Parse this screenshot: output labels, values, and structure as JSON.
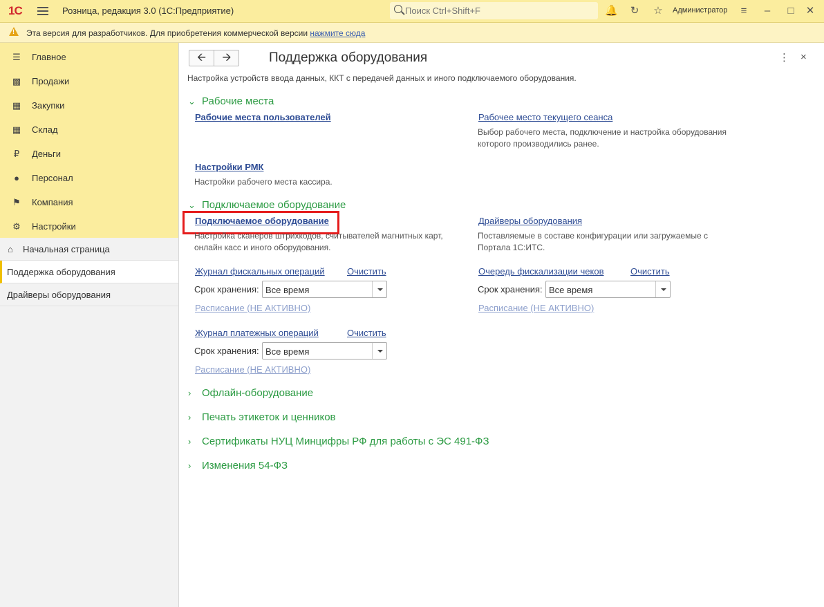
{
  "topbar": {
    "logo": "1С",
    "app_title": "Розница, редакция 3.0  (1С:Предприятие)",
    "search_placeholder": "Поиск Ctrl+Shift+F",
    "user": "Администратор",
    "icons": [
      "bell-icon",
      "history-icon",
      "star-icon",
      "settings-icon",
      "minimize-icon",
      "maximize-icon",
      "close-icon"
    ]
  },
  "warning": {
    "text": "Эта версия для разработчиков. Для приобретения коммерческой версии ",
    "link": "нажмите сюда"
  },
  "sections": [
    {
      "label": "Главное",
      "icon": "menu-icon"
    },
    {
      "label": "Продажи",
      "icon": "basket-icon"
    },
    {
      "label": "Закупки",
      "icon": "cart-icon"
    },
    {
      "label": "Склад",
      "icon": "warehouse-icon"
    },
    {
      "label": "Деньги",
      "icon": "ruble-icon"
    },
    {
      "label": "Персонал",
      "icon": "people-icon"
    },
    {
      "label": "Компания",
      "icon": "flag-icon"
    },
    {
      "label": "Настройки",
      "icon": "gear-icon"
    }
  ],
  "open_windows": [
    {
      "label": "Начальная страница"
    },
    {
      "label": "Поддержка оборудования"
    },
    {
      "label": "Драйверы оборудования"
    }
  ],
  "main": {
    "title": "Поддержка оборудования",
    "description": "Настройка устройств ввода данных, ККТ с передачей данных и иного подключаемого оборудования.",
    "groups": {
      "workplaces": {
        "title": "Рабочие места",
        "users_link": "Рабочие места пользователей",
        "current_link": "Рабочее место текущего сеанса",
        "current_note": "Выбор рабочего места, подключение и настройка оборудования которого производились ранее.",
        "rmk_link": "Настройки РМК",
        "rmk_note": "Настройки рабочего места кассира."
      },
      "equipment": {
        "title": "Подключаемое оборудование",
        "equipment_link": "Подключаемое оборудование",
        "equipment_note": "Настройка сканеров штрихкодов, считывателей магнитных карт, онлайн касс и иного оборудования.",
        "drivers_link": "Драйверы оборудования",
        "drivers_note": "Поставляемые в составе конфигурации или загружаемые с Портала 1С:ИТС.",
        "fiscal_log_link": "Журнал фискальных операций",
        "clear": "Очистить",
        "storage_label": "Срок хранения:",
        "storage_value": "Все время",
        "schedule": "Расписание (НЕ АКТИВНО)",
        "queue_link": "Очередь фискализации чеков",
        "payment_log_link": "Журнал платежных операций"
      }
    },
    "collapsed_groups": [
      "Офлайн-оборудование",
      "Печать этикеток и ценников",
      "Сертификаты НУЦ Минцифры РФ для работы с ЭС 491-ФЗ",
      "Изменения 54-ФЗ"
    ]
  },
  "colors": {
    "topbar": "#fbed9e",
    "group_title": "#2c9b43",
    "link": "#2f4d95",
    "highlight": "#e51c1c"
  }
}
